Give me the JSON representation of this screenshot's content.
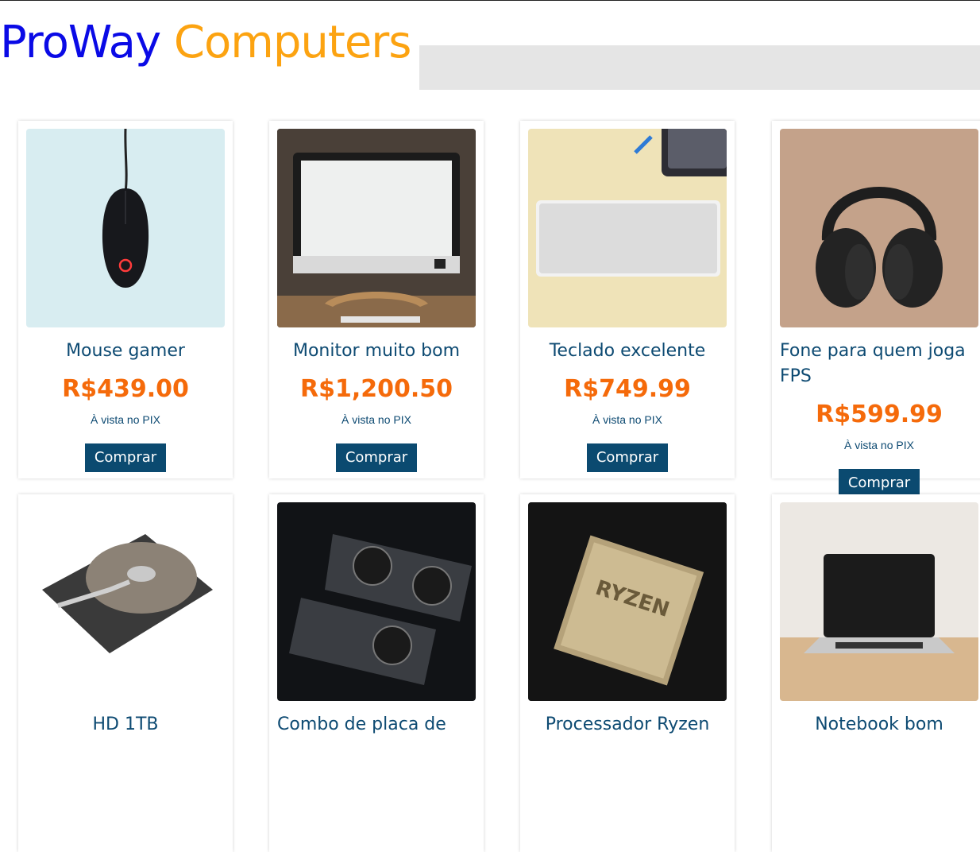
{
  "brand": {
    "part1": "ProWay",
    "part2": "Computers"
  },
  "products": [
    {
      "name": "Mouse gamer",
      "price": "R$439.00",
      "payment": "À vista no PIX",
      "button": "Comprar",
      "image": "mouse-image"
    },
    {
      "name": "Monitor muito bom",
      "price": "R$1,200.50",
      "payment": "À vista no PIX",
      "button": "Comprar",
      "image": "monitor-image"
    },
    {
      "name": "Teclado excelente",
      "price": "R$749.99",
      "payment": "À vista no PIX",
      "button": "Comprar",
      "image": "keyboard-image"
    },
    {
      "name": "Fone para quem joga FPS",
      "price": "R$599.99",
      "payment": "À vista no PIX",
      "button": "Comprar",
      "image": "headphones-image"
    },
    {
      "name": "HD 1TB",
      "image": "hard-drive-image"
    },
    {
      "name": "Combo de placa de",
      "image": "graphics-card-image"
    },
    {
      "name": "Processador Ryzen",
      "image": "ryzen-cpu-image"
    },
    {
      "name": "Notebook bom",
      "image": "laptop-image"
    }
  ],
  "colors": {
    "brand_blue": "#0a0ae6",
    "brand_orange": "#fca311",
    "title": "#0d4a72",
    "price": "#f56a0a",
    "button": "#0b4a70"
  }
}
